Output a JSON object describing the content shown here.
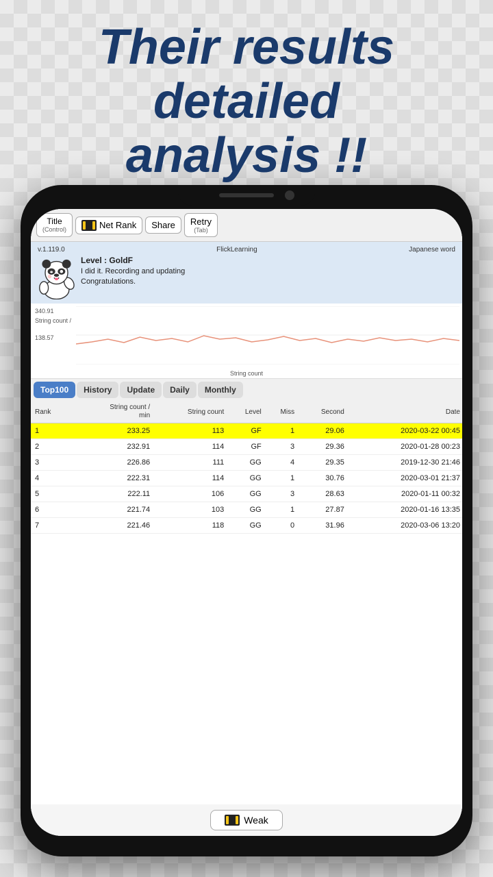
{
  "headline": {
    "line1": "Their results",
    "line2": "detailed",
    "line3": "analysis !!"
  },
  "toolbar": {
    "title_label": "Title",
    "title_sub": "(Control)",
    "netrank_label": "Net Rank",
    "share_label": "Share",
    "retry_label": "Retry",
    "retry_sub": "(Tab)"
  },
  "info_bar": {
    "version": "v.1.119.0",
    "app_name": "FlickLearning",
    "category": "Japanese word",
    "level": "Level : GoldF",
    "message": "I did it. Recording and updating",
    "congrats": "Congratulations."
  },
  "chart": {
    "y_top": "340.91",
    "y_bottom": "138.57",
    "label_left": "String count /",
    "xlabel": "String count"
  },
  "tabs": [
    {
      "id": "top100",
      "label": "Top100",
      "active": true
    },
    {
      "id": "history",
      "label": "History",
      "active": false
    },
    {
      "id": "update",
      "label": "Update",
      "active": false
    },
    {
      "id": "daily",
      "label": "Daily",
      "active": false
    },
    {
      "id": "monthly",
      "label": "Monthly",
      "active": false
    }
  ],
  "table": {
    "headers": {
      "rank": "Rank",
      "string_count_min": "String count / min",
      "string_count": "String count",
      "level": "Level",
      "miss": "Miss",
      "second": "Second",
      "date": "Date"
    },
    "rows": [
      {
        "rank": "1",
        "sc_min": "233.25",
        "sc": "113",
        "level": "GF",
        "miss": "1",
        "second": "29.06",
        "date": "2020-03-22 00:45",
        "highlight": true
      },
      {
        "rank": "2",
        "sc_min": "232.91",
        "sc": "114",
        "level": "GF",
        "miss": "3",
        "second": "29.36",
        "date": "2020-01-28 00:23",
        "highlight": false
      },
      {
        "rank": "3",
        "sc_min": "226.86",
        "sc": "111",
        "level": "GG",
        "miss": "4",
        "second": "29.35",
        "date": "2019-12-30 21:46",
        "highlight": false
      },
      {
        "rank": "4",
        "sc_min": "222.31",
        "sc": "114",
        "level": "GG",
        "miss": "1",
        "second": "30.76",
        "date": "2020-03-01 21:37",
        "highlight": false
      },
      {
        "rank": "5",
        "sc_min": "222.11",
        "sc": "106",
        "level": "GG",
        "miss": "3",
        "second": "28.63",
        "date": "2020-01-11 00:32",
        "highlight": false
      },
      {
        "rank": "6",
        "sc_min": "221.74",
        "sc": "103",
        "level": "GG",
        "miss": "1",
        "second": "27.87",
        "date": "2020-01-16 13:35",
        "highlight": false
      },
      {
        "rank": "7",
        "sc_min": "221.46",
        "sc": "118",
        "level": "GG",
        "miss": "0",
        "second": "31.96",
        "date": "2020-03-06 13:20",
        "highlight": false
      }
    ]
  },
  "weak_btn": {
    "label": "Weak"
  }
}
